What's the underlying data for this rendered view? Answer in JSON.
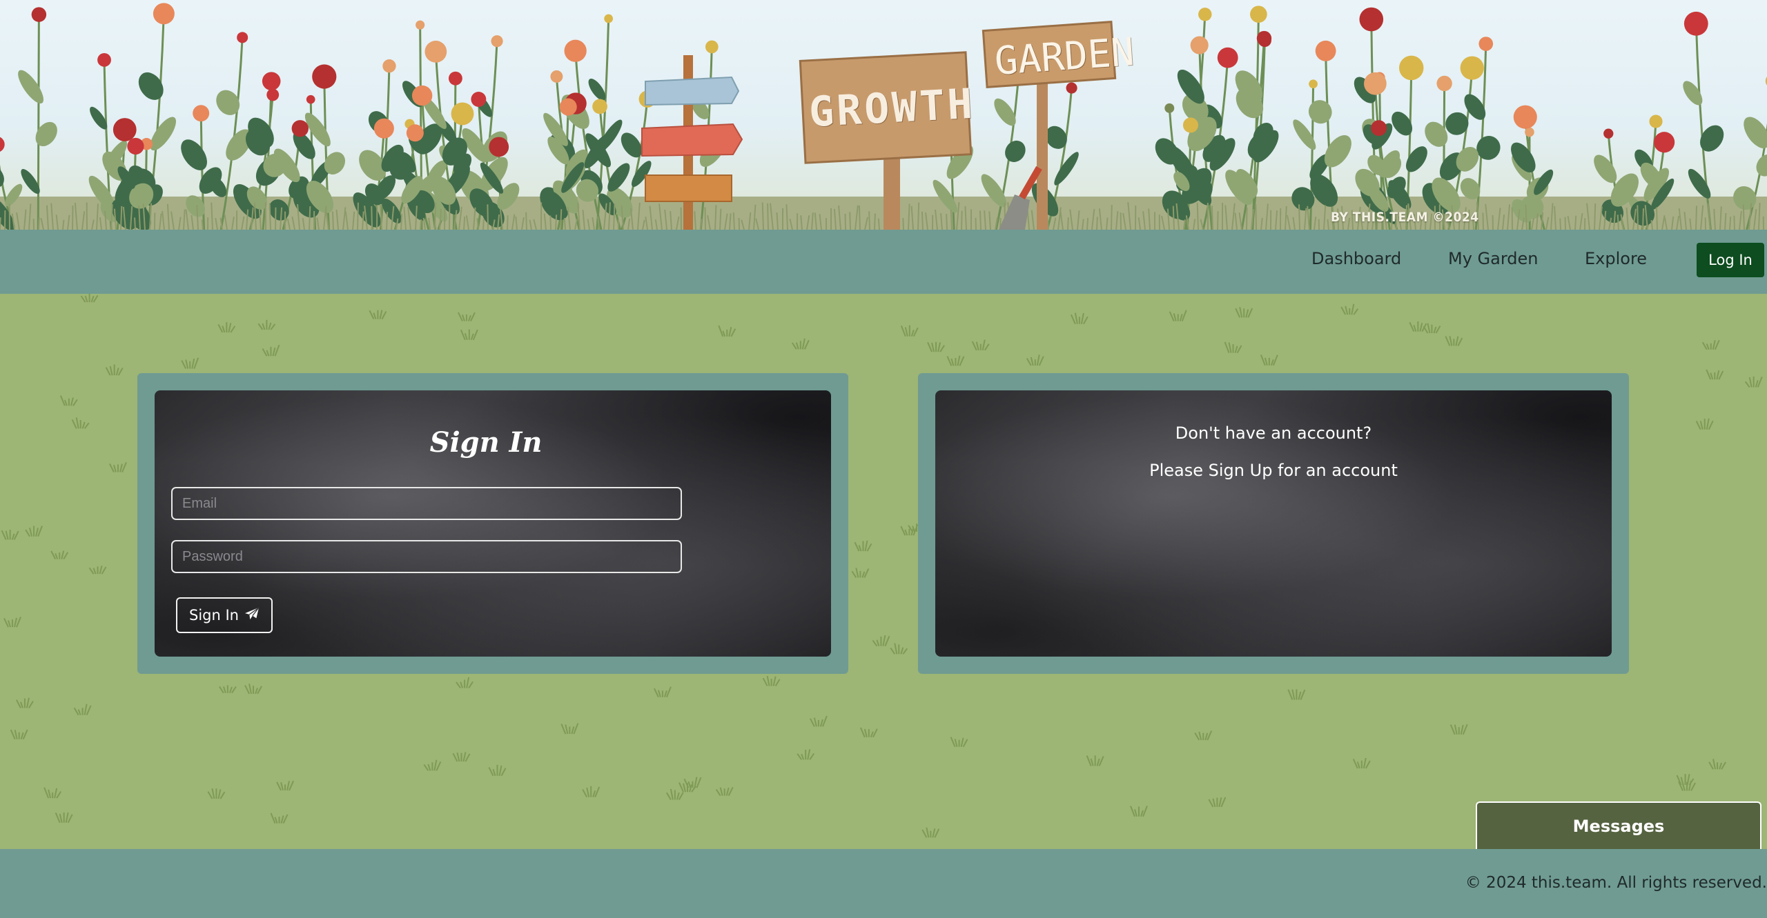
{
  "banner": {
    "sign_growth": "GROWTH",
    "sign_garden": "GARDEN",
    "credit": "BY THIS.TEAM ©2024"
  },
  "nav": {
    "items": [
      {
        "label": "Dashboard"
      },
      {
        "label": "My Garden"
      },
      {
        "label": "Explore"
      }
    ],
    "login_label": "Log In"
  },
  "signin": {
    "title": "Sign In",
    "email_placeholder": "Email",
    "password_placeholder": "Password",
    "button_label": "Sign In",
    "button_icon": "paper-plane-icon"
  },
  "signup": {
    "question": "Don't have an account?",
    "prompt": "Please Sign Up for an account"
  },
  "messages": {
    "label": "Messages"
  },
  "footer": {
    "text": "© 2024 this.team. All rights reserved."
  },
  "colors": {
    "nav_bg": "#6f9b92",
    "grass_bg": "#9db575",
    "login_button": "#0d4d1f",
    "messages_tab": "#556340",
    "chalkboard": "#3b3b3f"
  }
}
